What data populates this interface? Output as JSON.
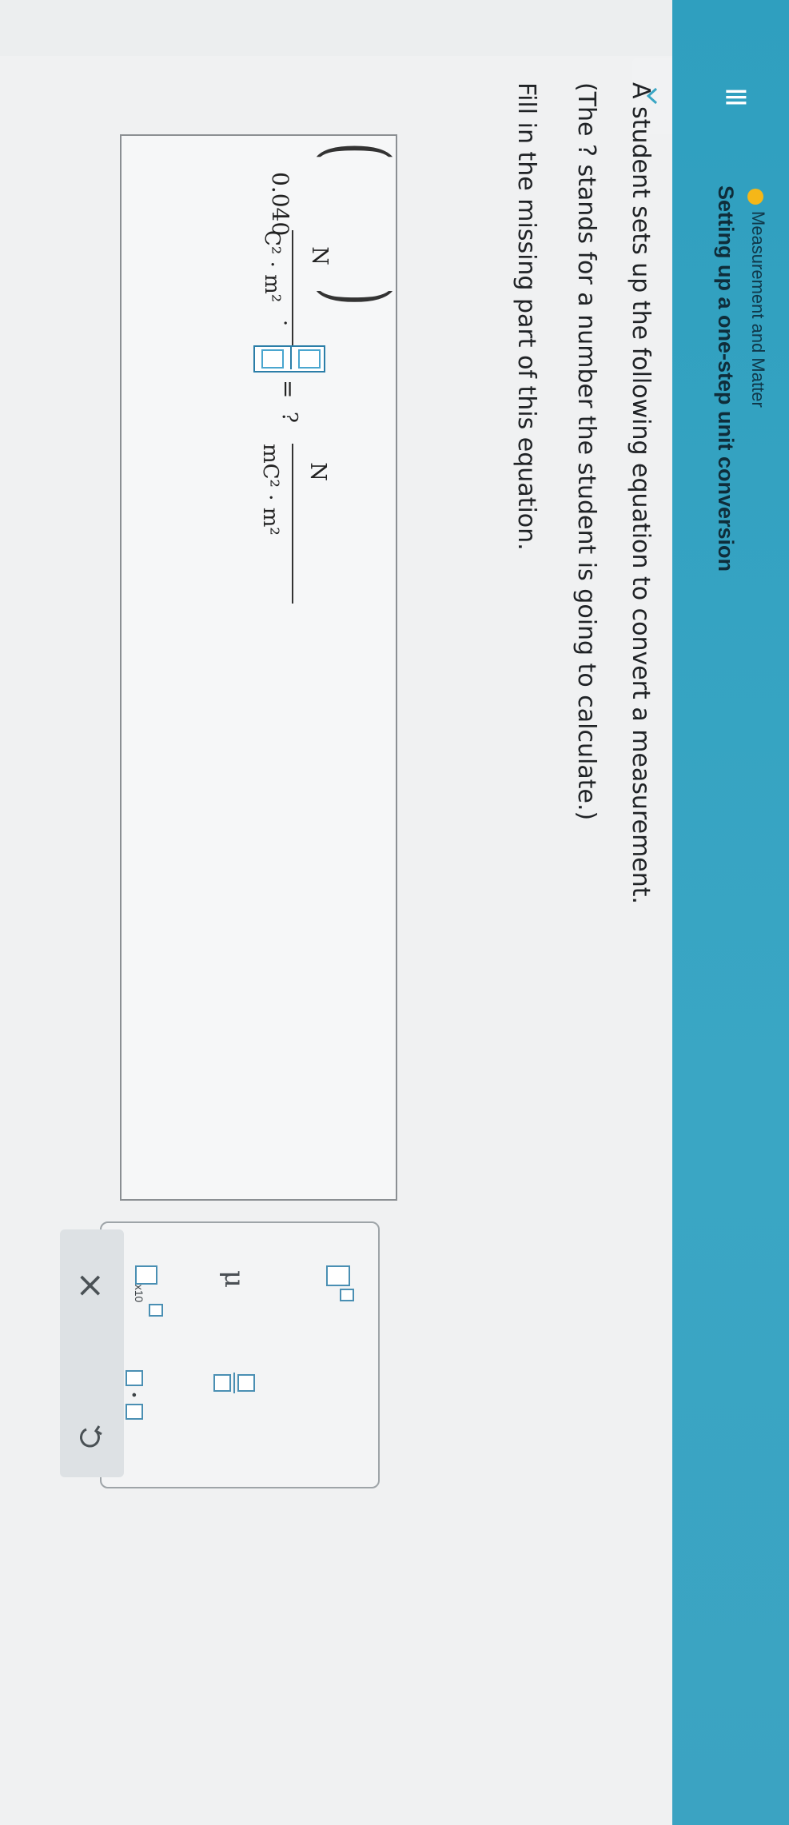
{
  "header": {
    "topic": "Measurement and Matter",
    "subtitle": "Setting up a one-step unit conversion"
  },
  "question": {
    "line1": "A student sets up the following equation to convert a measurement.",
    "line2": "(The ? stands for a number the student is going to calculate.)",
    "line3": "Fill in the missing part of this equation."
  },
  "equation": {
    "coefficient": "0.040",
    "left_numerator": "N",
    "left_denominator": "C² · m²",
    "dot": "·",
    "equals": "=",
    "unknown": "?",
    "right_numerator": "N",
    "right_denominator": "mC² · m²"
  },
  "tools": {
    "mu": "μ",
    "x10": "x10",
    "dot": "•",
    "clear": "×"
  },
  "colors": {
    "header": "#3aa6c4",
    "topic_dot": "#f5b718",
    "tool_accent": "#4a8fb3"
  }
}
